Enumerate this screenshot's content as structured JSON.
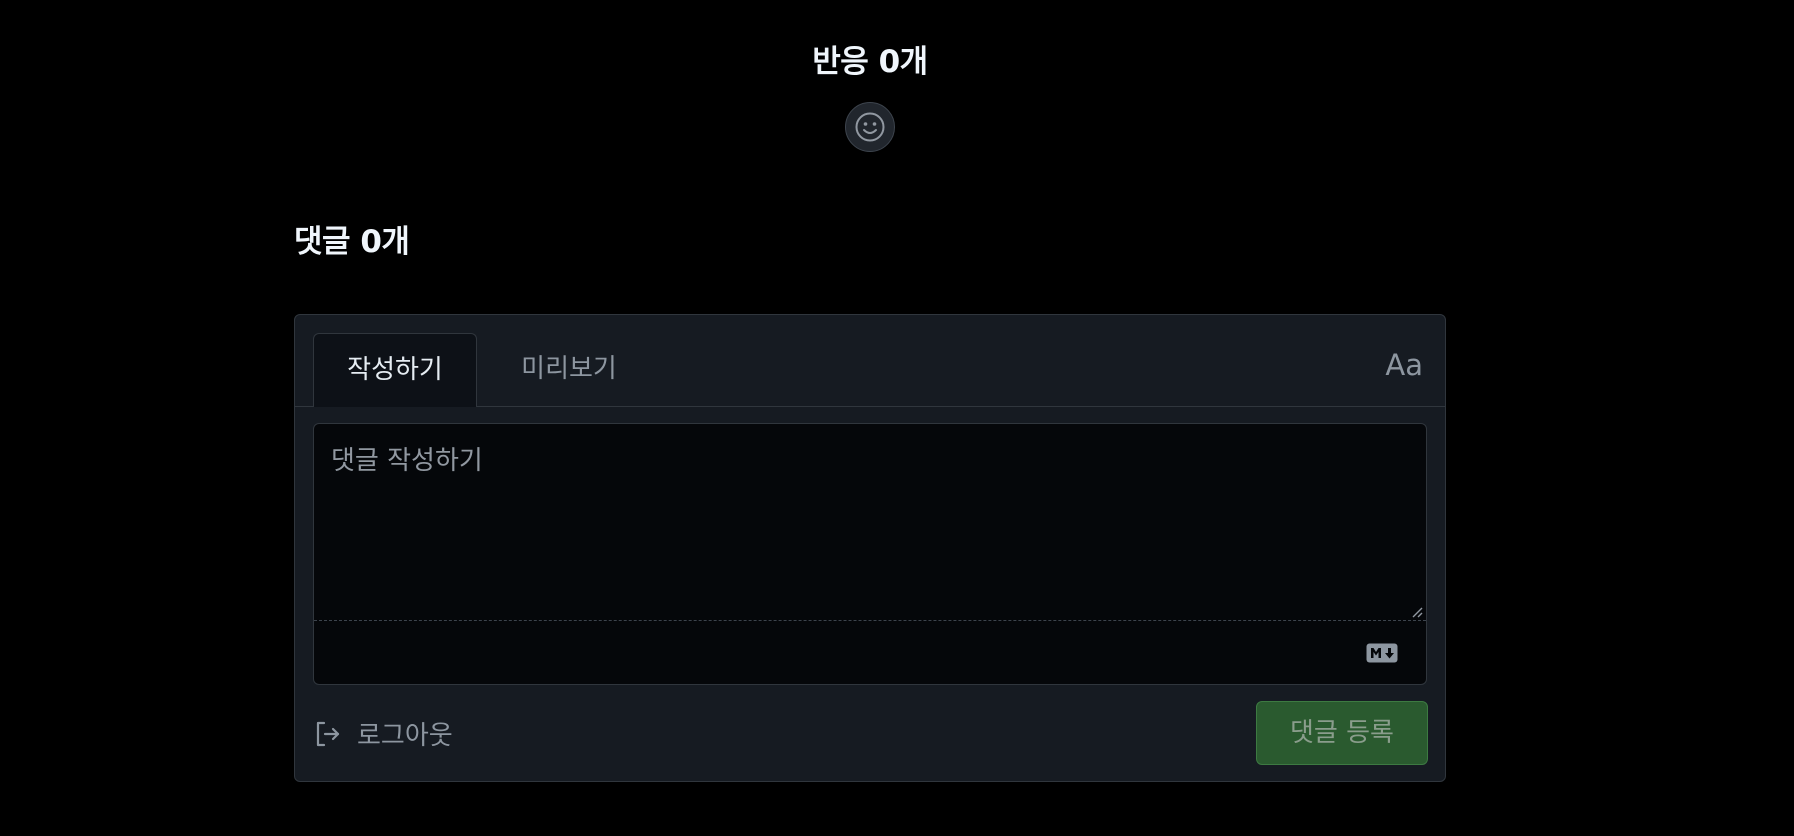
{
  "reactions": {
    "title": "반응 0개",
    "add_icon": "smiley-icon"
  },
  "comments": {
    "title": "댓글 0개"
  },
  "editor": {
    "tabs": [
      {
        "label": "작성하기",
        "active": true
      },
      {
        "label": "미리보기",
        "active": false
      }
    ],
    "font_toggle_label": "Aa",
    "textarea_placeholder": "댓글 작성하기",
    "textarea_value": "",
    "markdown_icon": "markdown-icon",
    "logout_icon": "sign-out-icon",
    "logout_label": "로그아웃",
    "submit_label": "댓글 등록"
  },
  "colors": {
    "background": "#000000",
    "panel": "#161b22",
    "border": "#30363d",
    "submit_bg": "#2a5a2f"
  }
}
